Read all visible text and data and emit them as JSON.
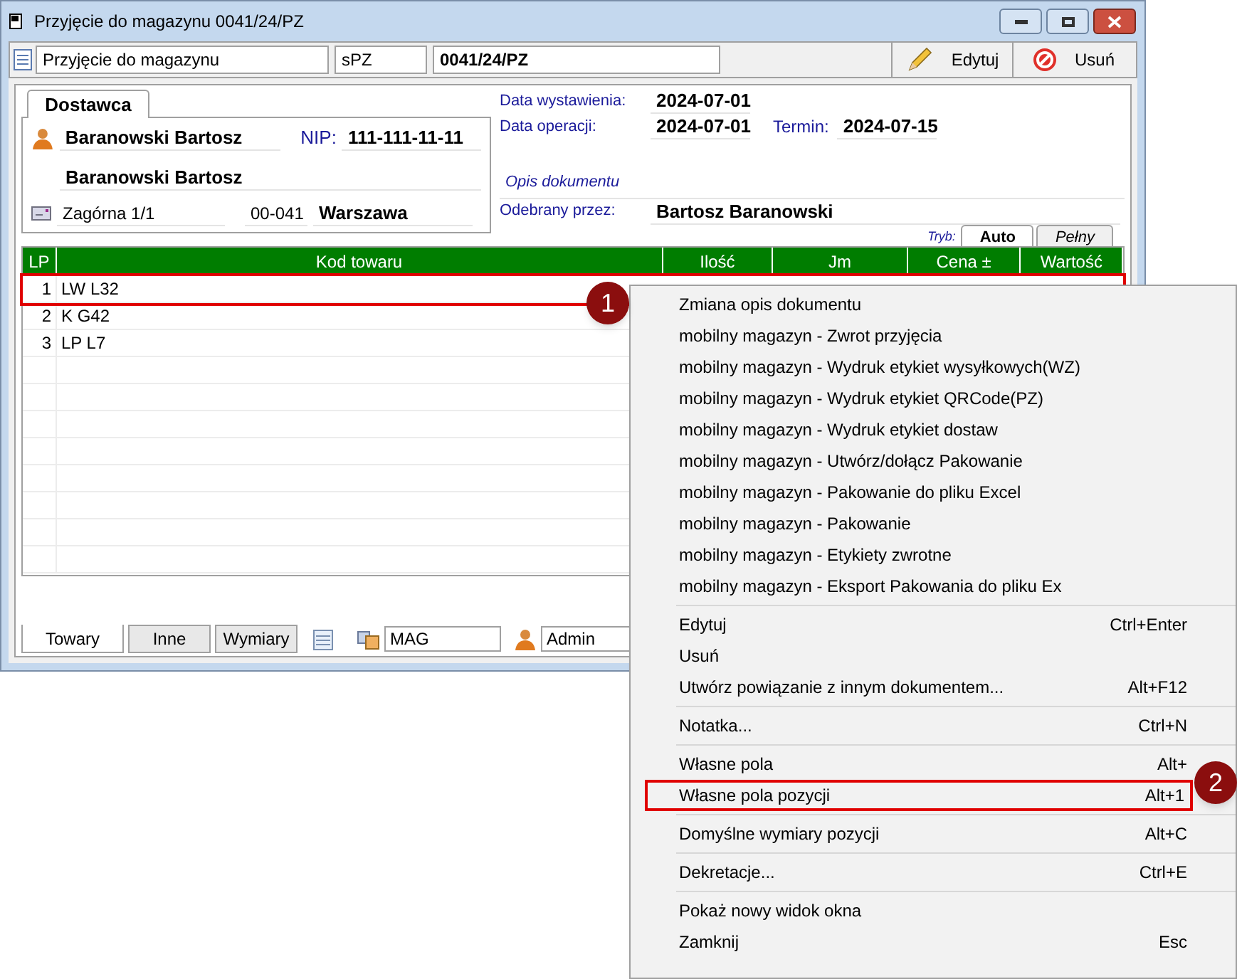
{
  "window": {
    "title": "Przyjęcie do magazynu 0041/24/PZ"
  },
  "toolbar": {
    "document_type": "Przyjęcie do magazynu",
    "series": "sPZ",
    "number": "0041/24/PZ",
    "buttons": [
      {
        "label": "Edytuj",
        "kind": "edit"
      },
      {
        "label": "Usuń",
        "kind": "delete"
      }
    ]
  },
  "supplier": {
    "tab": "Dostawca",
    "name": "Baranowski Bartosz",
    "nip_label": "NIP:",
    "nip": "111-111-11-11",
    "name2": "Baranowski Bartosz",
    "street": "Zagórna 1/1",
    "postal_code": "00-041",
    "city": "Warszawa"
  },
  "dates": [
    {
      "label": "Data wystawienia:",
      "value": "2024-07-01"
    },
    {
      "label": "Data operacji:",
      "value": "2024-07-01",
      "extra_label": "Termin:",
      "extra_value": "2024-07-15"
    }
  ],
  "description": {
    "heading": "Opis dokumentu",
    "receiver_label": "Odebrany przez:",
    "receiver": "Bartosz Baranowski"
  },
  "mode": {
    "label": "Tryb:",
    "tabs": [
      {
        "label": "Auto",
        "selected": true
      },
      {
        "label": "Pełny",
        "selected": false
      }
    ]
  },
  "table": {
    "columns": [
      "LP",
      "Kod towaru",
      "Ilość",
      "Jm",
      "Cena ±",
      "Wartość"
    ],
    "rows": [
      {
        "lp": "1",
        "code": "LW L32",
        "marked": true
      },
      {
        "lp": "2",
        "code": "K G42",
        "marked": false
      },
      {
        "lp": "3",
        "code": "LP L7",
        "marked": false
      }
    ]
  },
  "bottom_tabs": [
    {
      "label": "Towary",
      "selected": true
    },
    {
      "label": "Inne",
      "selected": false
    },
    {
      "label": "Wymiary",
      "selected": false
    }
  ],
  "warehouse": "MAG",
  "user": "Admin",
  "context_menu": {
    "groups": [
      [
        {
          "label": "Zmiana opis dokumentu",
          "marked": false
        },
        {
          "label": "mobilny magazyn - Zwrot przyjęcia",
          "marked": false
        },
        {
          "label": "mobilny magazyn - Wydruk etykiet wysyłkowych(WZ)",
          "marked": false
        },
        {
          "label": "mobilny magazyn - Wydruk etykiet QRCode(PZ)",
          "marked": false
        },
        {
          "label": "mobilny magazyn - Wydruk etykiet dostaw",
          "marked": false
        },
        {
          "label": "mobilny magazyn - Utwórz/dołącz Pakowanie",
          "marked": false
        },
        {
          "label": "mobilny magazyn - Pakowanie do pliku Excel",
          "marked": false
        },
        {
          "label": "mobilny magazyn - Pakowanie",
          "marked": false
        },
        {
          "label": "mobilny magazyn - Etykiety zwrotne",
          "marked": false
        },
        {
          "label": "mobilny magazyn - Eksport Pakowania do pliku Ex",
          "marked": false
        }
      ],
      [
        {
          "label": "Edytuj",
          "shortcut": "Ctrl+Enter",
          "marked": false
        },
        {
          "label": "Usuń",
          "marked": false
        },
        {
          "label": "Utwórz powiązanie z innym dokumentem...",
          "shortcut": "Alt+F12",
          "marked": false
        }
      ],
      [
        {
          "label": "Notatka...",
          "shortcut": "Ctrl+N",
          "marked": false
        }
      ],
      [
        {
          "label": "Własne pola",
          "shortcut": "Alt+",
          "marked": false
        },
        {
          "label": "Własne pola pozycji",
          "shortcut": "Alt+1",
          "marked": true
        }
      ],
      [
        {
          "label": "Domyślne wymiary pozycji",
          "shortcut": "Alt+C",
          "marked": false
        }
      ],
      [
        {
          "label": "Dekretacje...",
          "shortcut": "Ctrl+E",
          "marked": false
        }
      ],
      [
        {
          "label": "Pokaż nowy widok okna",
          "marked": false
        },
        {
          "label": "Zamknij",
          "shortcut": "Esc",
          "marked": false
        }
      ]
    ]
  },
  "callouts": [
    "1",
    "2"
  ]
}
